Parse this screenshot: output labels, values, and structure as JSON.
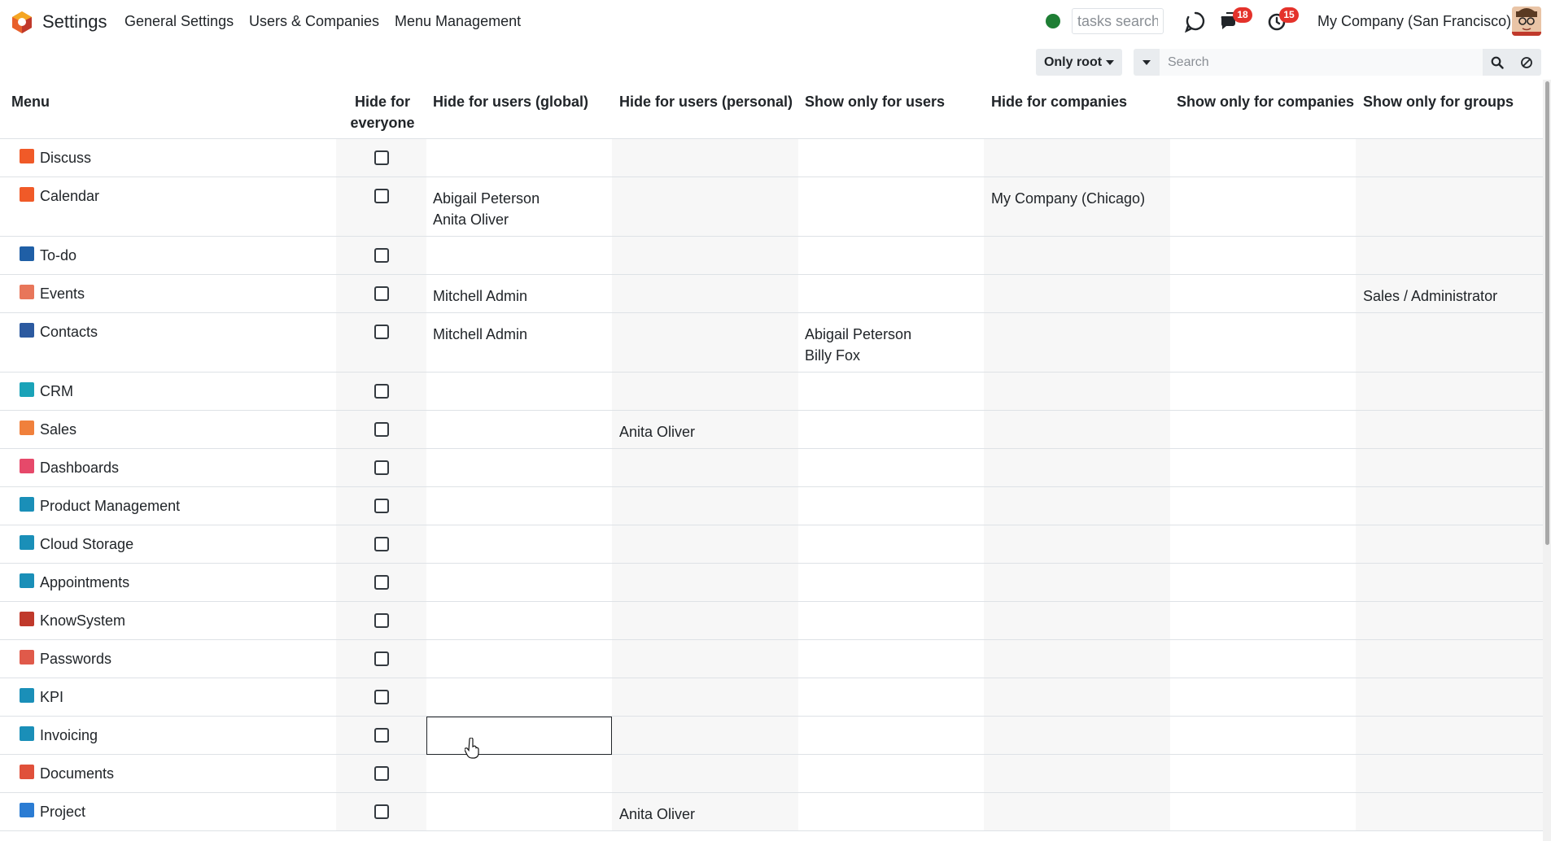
{
  "app": {
    "name": "Settings",
    "menus": [
      "General Settings",
      "Users & Companies",
      "Menu Management"
    ],
    "tasks_search_placeholder": "tasks search",
    "messages_count": "18",
    "activities_count": "15",
    "company": "My Company (San Francisco)"
  },
  "controls": {
    "filter_label": "Only root",
    "search_placeholder": "Search"
  },
  "table": {
    "columns": {
      "menu": "Menu",
      "hide_everyone": "Hide for everyone",
      "hide_users_global": "Hide for users (global)",
      "hide_users_personal": "Hide for users (personal)",
      "show_only_users": "Show only for users",
      "hide_companies": "Hide for companies",
      "show_only_companies": "Show only for companies",
      "show_only_groups": "Show only for groups"
    },
    "rows": [
      {
        "menu": "Discuss",
        "icon": "discuss-icon",
        "color": "#f05a28",
        "hide_everyone": false,
        "hide_users_global": "",
        "hide_users_personal": "",
        "show_only_users": "",
        "hide_companies": "",
        "show_only_companies": "",
        "show_only_groups": ""
      },
      {
        "menu": "Calendar",
        "icon": "calendar-icon",
        "color": "#f05a28",
        "hide_everyone": false,
        "hide_users_global": "Abigail Peterson\nAnita Oliver",
        "hide_users_personal": "",
        "show_only_users": "",
        "hide_companies": "My Company (Chicago)",
        "show_only_companies": "",
        "show_only_groups": ""
      },
      {
        "menu": "To-do",
        "icon": "todo-icon",
        "color": "#1f5fa6",
        "hide_everyone": false,
        "hide_users_global": "",
        "hide_users_personal": "",
        "show_only_users": "",
        "hide_companies": "",
        "show_only_companies": "",
        "show_only_groups": ""
      },
      {
        "menu": "Events",
        "icon": "events-icon",
        "color": "#e8765a",
        "hide_everyone": false,
        "hide_users_global": "Mitchell Admin",
        "hide_users_personal": "",
        "show_only_users": "",
        "hide_companies": "",
        "show_only_companies": "",
        "show_only_groups": "Sales / Administrator"
      },
      {
        "menu": "Contacts",
        "icon": "contacts-icon",
        "color": "#2c5aa0",
        "hide_everyone": false,
        "hide_users_global": "Mitchell Admin",
        "hide_users_personal": "",
        "show_only_users": "Abigail Peterson\nBilly Fox",
        "hide_companies": "",
        "show_only_companies": "",
        "show_only_groups": ""
      },
      {
        "menu": "CRM",
        "icon": "crm-icon",
        "color": "#1aa3b8",
        "hide_everyone": false,
        "hide_users_global": "",
        "hide_users_personal": "",
        "show_only_users": "",
        "hide_companies": "",
        "show_only_companies": "",
        "show_only_groups": ""
      },
      {
        "menu": "Sales",
        "icon": "sales-icon",
        "color": "#f0803c",
        "hide_everyone": false,
        "hide_users_global": "",
        "hide_users_personal": "Anita Oliver",
        "show_only_users": "",
        "hide_companies": "",
        "show_only_companies": "",
        "show_only_groups": ""
      },
      {
        "menu": "Dashboards",
        "icon": "dashboards-icon",
        "color": "#e6496a",
        "hide_everyone": false,
        "hide_users_global": "",
        "hide_users_personal": "",
        "show_only_users": "",
        "hide_companies": "",
        "show_only_companies": "",
        "show_only_groups": ""
      },
      {
        "menu": "Product Management",
        "icon": "product-management-icon",
        "color": "#1a8fb8",
        "hide_everyone": false,
        "hide_users_global": "",
        "hide_users_personal": "",
        "show_only_users": "",
        "hide_companies": "",
        "show_only_companies": "",
        "show_only_groups": ""
      },
      {
        "menu": "Cloud Storage",
        "icon": "cloud-storage-icon",
        "color": "#1a8fb8",
        "hide_everyone": false,
        "hide_users_global": "",
        "hide_users_personal": "",
        "show_only_users": "",
        "hide_companies": "",
        "show_only_companies": "",
        "show_only_groups": ""
      },
      {
        "menu": "Appointments",
        "icon": "appointments-icon",
        "color": "#1a8fb8",
        "hide_everyone": false,
        "hide_users_global": "",
        "hide_users_personal": "",
        "show_only_users": "",
        "hide_companies": "",
        "show_only_companies": "",
        "show_only_groups": ""
      },
      {
        "menu": "KnowSystem",
        "icon": "knowsystem-icon",
        "color": "#c0392b",
        "hide_everyone": false,
        "hide_users_global": "",
        "hide_users_personal": "",
        "show_only_users": "",
        "hide_companies": "",
        "show_only_companies": "",
        "show_only_groups": ""
      },
      {
        "menu": "Passwords",
        "icon": "passwords-icon",
        "color": "#e05a4a",
        "hide_everyone": false,
        "hide_users_global": "",
        "hide_users_personal": "",
        "show_only_users": "",
        "hide_companies": "",
        "show_only_companies": "",
        "show_only_groups": ""
      },
      {
        "menu": "KPI",
        "icon": "kpi-icon",
        "color": "#1a8fb8",
        "hide_everyone": false,
        "hide_users_global": "",
        "hide_users_personal": "",
        "show_only_users": "",
        "hide_companies": "",
        "show_only_companies": "",
        "show_only_groups": ""
      },
      {
        "menu": "Invoicing",
        "icon": "invoicing-icon",
        "color": "#1a8fb8",
        "hide_everyone": false,
        "hide_users_global": "",
        "hide_users_personal": "",
        "show_only_users": "",
        "hide_companies": "",
        "show_only_companies": "",
        "show_only_groups": ""
      },
      {
        "menu": "Documents",
        "icon": "documents-icon",
        "color": "#e0503a",
        "hide_everyone": false,
        "hide_users_global": "",
        "hide_users_personal": "",
        "show_only_users": "",
        "hide_companies": "",
        "show_only_companies": "",
        "show_only_groups": ""
      },
      {
        "menu": "Project",
        "icon": "project-icon",
        "color": "#2b7cd3",
        "hide_everyone": false,
        "hide_users_global": "",
        "hide_users_personal": "Anita Oliver",
        "show_only_users": "",
        "hide_companies": "",
        "show_only_companies": "",
        "show_only_groups": ""
      }
    ]
  }
}
